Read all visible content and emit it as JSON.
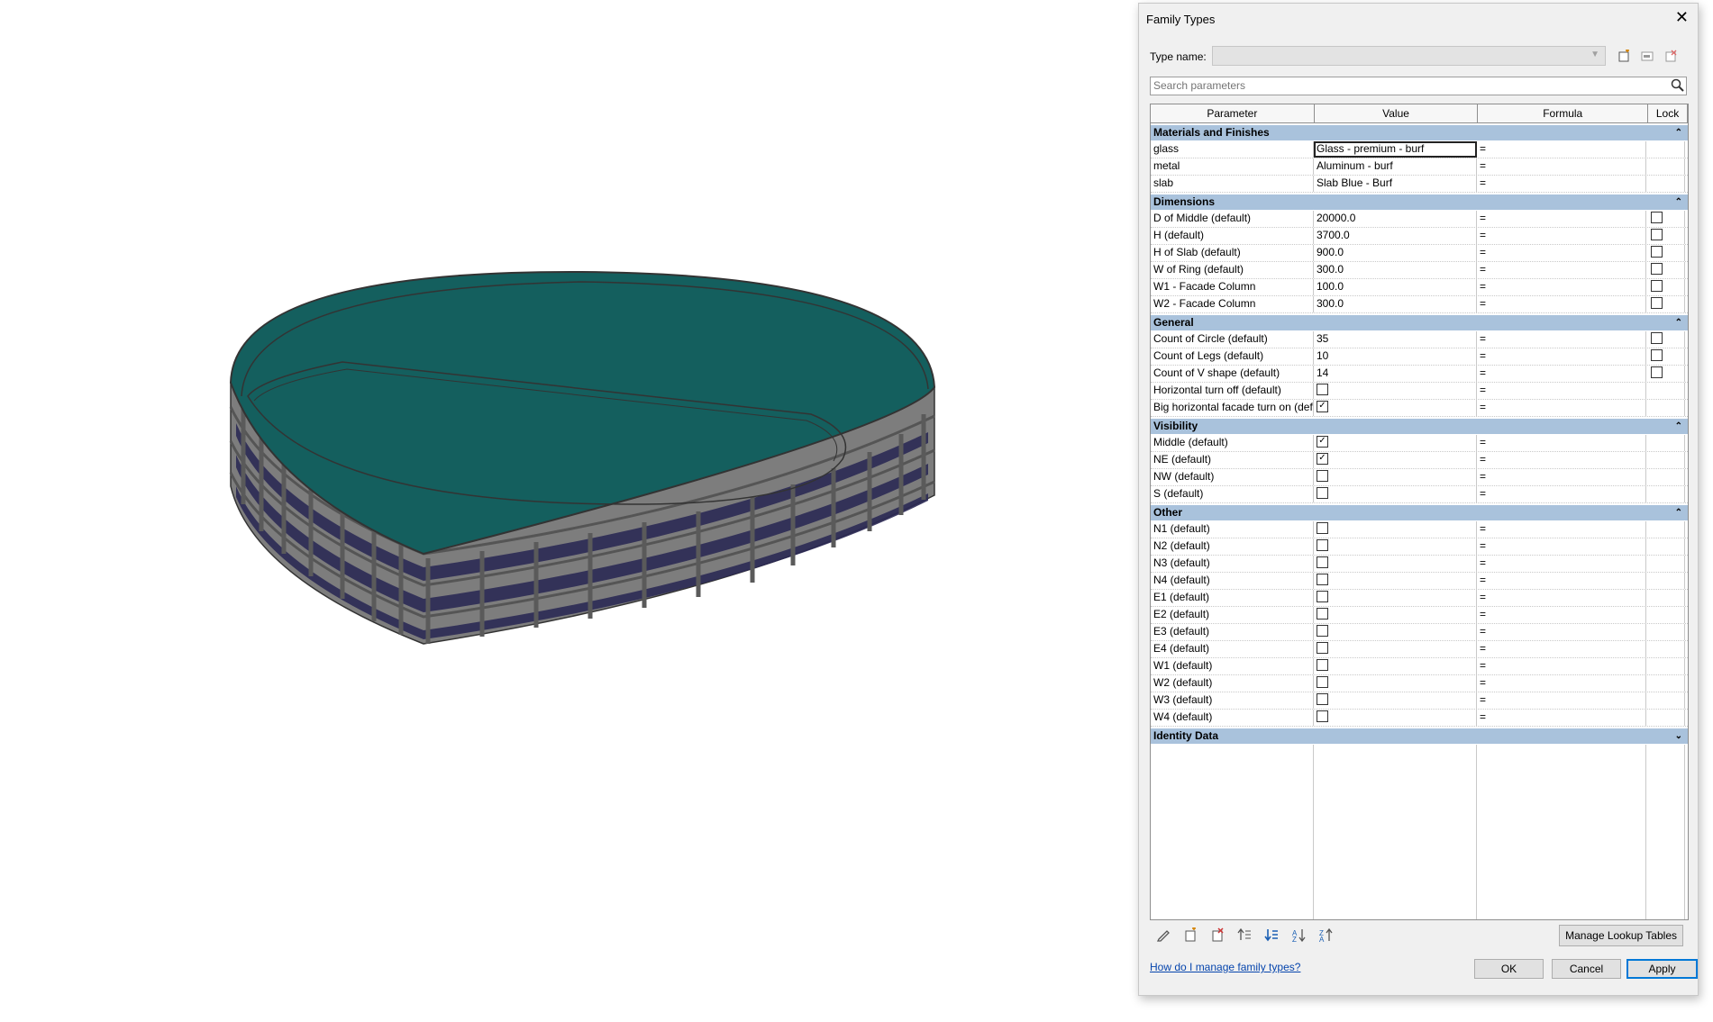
{
  "dialog": {
    "title": "Family Types",
    "type_name_label": "Type name:",
    "type_name_value": "",
    "search_placeholder": "Search parameters",
    "columns": [
      "Parameter",
      "Value",
      "Formula",
      "Lock"
    ],
    "groups": [
      {
        "name": "Materials and Finishes",
        "collapse": "up",
        "rows": [
          {
            "param": "glass",
            "value": "Glass - premium - burf",
            "formula": "=",
            "lock": null,
            "active": true
          },
          {
            "param": "metal",
            "value": "Aluminum - burf",
            "formula": "=",
            "lock": null
          },
          {
            "param": "slab",
            "value": "Slab Blue - Burf",
            "formula": "=",
            "lock": null
          }
        ]
      },
      {
        "name": "Dimensions",
        "collapse": "up",
        "rows": [
          {
            "param": "D of Middle (default)",
            "value": "20000.0",
            "formula": "=",
            "lock": false
          },
          {
            "param": "H (default)",
            "value": "3700.0",
            "formula": "=",
            "lock": false
          },
          {
            "param": "H of Slab (default)",
            "value": "900.0",
            "formula": "=",
            "lock": false
          },
          {
            "param": "W of Ring (default)",
            "value": "300.0",
            "formula": "=",
            "lock": false
          },
          {
            "param": "W1 - Facade Column",
            "value": "100.0",
            "formula": "=",
            "lock": false
          },
          {
            "param": "W2 - Facade Column",
            "value": "300.0",
            "formula": "=",
            "lock": false
          }
        ]
      },
      {
        "name": "General",
        "collapse": "up",
        "rows": [
          {
            "param": "Count of Circle (default)",
            "value": "35",
            "formula": "=",
            "lock": false
          },
          {
            "param": "Count of Legs (default)",
            "value": "10",
            "formula": "=",
            "lock": false
          },
          {
            "param": "Count of V shape (default)",
            "value": "14",
            "formula": "=",
            "lock": false
          },
          {
            "param": "Horizontal turn off (default)",
            "check": false,
            "formula": "=",
            "lock": null
          },
          {
            "param": "Big horizontal facade turn on (def",
            "check": true,
            "formula": "=",
            "lock": null
          }
        ]
      },
      {
        "name": "Visibility",
        "collapse": "up",
        "rows": [
          {
            "param": "Middle (default)",
            "check": true,
            "formula": "=",
            "lock": null
          },
          {
            "param": "NE (default)",
            "check": true,
            "formula": "=",
            "lock": null
          },
          {
            "param": "NW (default)",
            "check": false,
            "formula": "=",
            "lock": null
          },
          {
            "param": "S (default)",
            "check": false,
            "formula": "=",
            "lock": null
          }
        ]
      },
      {
        "name": "Other",
        "collapse": "up",
        "rows": [
          {
            "param": "N1 (default)",
            "check": false,
            "formula": "=",
            "lock": null
          },
          {
            "param": "N2 (default)",
            "check": false,
            "formula": "=",
            "lock": null
          },
          {
            "param": "N3 (default)",
            "check": false,
            "formula": "=",
            "lock": null
          },
          {
            "param": "N4 (default)",
            "check": false,
            "formula": "=",
            "lock": null
          },
          {
            "param": "E1 (default)",
            "check": false,
            "formula": "=",
            "lock": null
          },
          {
            "param": "E2 (default)",
            "check": false,
            "formula": "=",
            "lock": null
          },
          {
            "param": "E3 (default)",
            "check": false,
            "formula": "=",
            "lock": null
          },
          {
            "param": "E4 (default)",
            "check": false,
            "formula": "=",
            "lock": null
          },
          {
            "param": "W1 (default)",
            "check": false,
            "formula": "=",
            "lock": null
          },
          {
            "param": "W2 (default)",
            "check": false,
            "formula": "=",
            "lock": null
          },
          {
            "param": "W3 (default)",
            "check": false,
            "formula": "=",
            "lock": null
          },
          {
            "param": "W4 (default)",
            "check": false,
            "formula": "=",
            "lock": null
          }
        ]
      },
      {
        "name": "Identity Data",
        "collapse": "down",
        "rows": []
      }
    ],
    "toolbar_icons": [
      "pencil-icon",
      "new-parameter-icon",
      "delete-parameter-icon",
      "move-up-icon",
      "move-down-icon",
      "sort-ascending-icon",
      "sort-descending-icon"
    ],
    "manage_lookup_label": "Manage Lookup Tables",
    "help_link": "How do I manage family types?",
    "ok_label": "OK",
    "cancel_label": "Cancel",
    "apply_label": "Apply"
  },
  "colors": {
    "roof": "#145f5e",
    "frame": "#8c8c8c",
    "glass": "#2c2a55",
    "group_header": "#a9c2dc",
    "apply_border": "#0078d7"
  }
}
